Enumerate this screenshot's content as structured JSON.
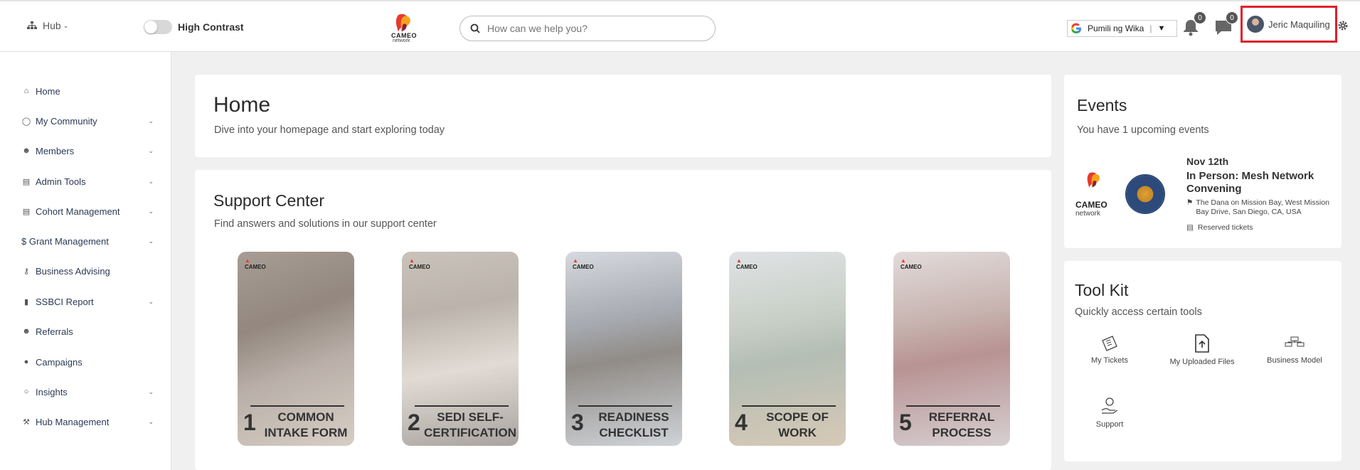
{
  "header": {
    "hub_label": "Hub",
    "high_contrast_label": "High Contrast",
    "logo_text": "CAMEO",
    "logo_sub": "network",
    "search_placeholder": "How can we help you?",
    "translate_label": "Pumili ng Wika",
    "notifications_count": "0",
    "messages_count": "0",
    "user_name": "Jeric Maquiling"
  },
  "sidebar": {
    "items": [
      {
        "label": "Home",
        "icon": "home-icon",
        "has_children": false
      },
      {
        "label": "My Community",
        "icon": "community-icon",
        "has_children": true
      },
      {
        "label": "Members",
        "icon": "user-circle-icon",
        "has_children": true
      },
      {
        "label": "Admin Tools",
        "icon": "admin-icon",
        "has_children": true
      },
      {
        "label": "Cohort Management",
        "icon": "cohort-icon",
        "has_children": true
      },
      {
        "label": "$ Grant Management",
        "icon": "none",
        "has_children": true
      },
      {
        "label": "Business Advising",
        "icon": "key-icon",
        "has_children": false
      },
      {
        "label": "SSBCI Report",
        "icon": "file-icon",
        "has_children": true
      },
      {
        "label": "Referrals",
        "icon": "user-plus-icon",
        "has_children": false
      },
      {
        "label": "Campaigns",
        "icon": "chat-icon",
        "has_children": false
      },
      {
        "label": "Insights",
        "icon": "lightbulb-icon",
        "has_children": true
      },
      {
        "label": "Hub Management",
        "icon": "wrench-icon",
        "has_children": true
      }
    ]
  },
  "home": {
    "title": "Home",
    "subtitle": "Dive into your homepage and start exploring today"
  },
  "support": {
    "title": "Support Center",
    "subtitle": "Find answers and solutions in our support center",
    "tiles": [
      {
        "number": "1",
        "caption": "COMMON INTAKE FORM"
      },
      {
        "number": "2",
        "caption": "SEDI SELF-CERTIFICATION"
      },
      {
        "number": "3",
        "caption": "READINESS CHECKLIST"
      },
      {
        "number": "4",
        "caption": "SCOPE OF WORK"
      },
      {
        "number": "5",
        "caption": "REFERRAL PROCESS"
      }
    ]
  },
  "events": {
    "title": "Events",
    "subtitle": "You have 1 upcoming events",
    "item": {
      "date": "Nov 12th",
      "title": "In Person: Mesh Network Convening",
      "location": "The Dana on Mission Bay, West Mission Bay Drive, San Diego, CA, USA",
      "tickets": "Reserved tickets"
    }
  },
  "toolkit": {
    "title": "Tool Kit",
    "subtitle": "Quickly access certain tools",
    "tools": [
      {
        "label": "My Tickets"
      },
      {
        "label": "My Uploaded Files"
      },
      {
        "label": "Business Model"
      },
      {
        "label": "Support"
      }
    ]
  },
  "colors": {
    "accent_red": "#e0202a",
    "nav_text": "#2b3a55",
    "page_bg": "#f0f0f0"
  }
}
